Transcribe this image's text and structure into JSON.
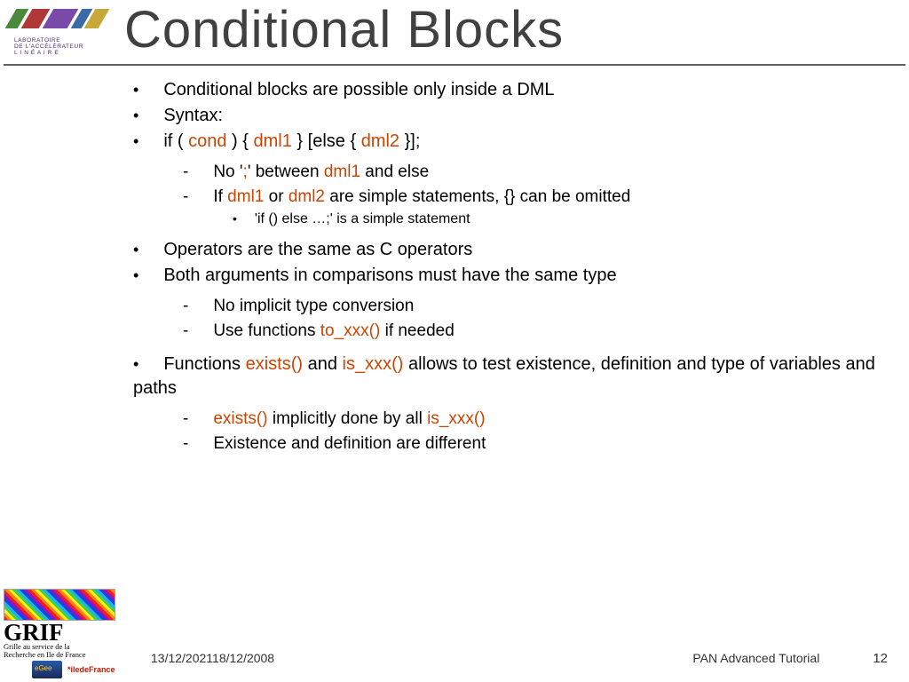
{
  "header": {
    "title": "Conditional Blocks",
    "logo_text_line1": "LABORATOIRE",
    "logo_text_line2": "DE L'ACCÉLÉRATEUR",
    "logo_text_line3": "L I N É A I R E"
  },
  "bullets": {
    "b1": "Conditional blocks are possible only inside a DML",
    "b2": "Syntax:",
    "b3_pre": "if ( ",
    "b3_cond": "cond",
    "b3_mid1": " ) { ",
    "b3_dml1": "dml1",
    "b3_mid2": " } [else { ",
    "b3_dml2": "dml2",
    "b3_end": " }];",
    "s1_a": "No '",
    "s1_b": ";",
    "s1_c": "' between ",
    "s1_d": "dml1",
    "s1_e": " and else",
    "s2_a": "If ",
    "s2_b": "dml1",
    "s2_c": " or ",
    "s2_d": "dml2",
    "s2_e": " are simple statements, {} can be omitted",
    "ss1": "'if () else …;' is a simple statement",
    "b4": "Operators are the same as C operators",
    "b5": "Both arguments in comparisons must have the same type",
    "s3": "No implicit type conversion",
    "s4_a": "Use functions ",
    "s4_b": "to_xxx()",
    "s4_c": " if needed",
    "b6_a": "Functions ",
    "b6_b": "exists()",
    "b6_c": " and ",
    "b6_d": "is_xxx()",
    "b6_e": " allows to test existence, definition and type of variables and paths",
    "s5_a": "exists()",
    "s5_b": " implicitly done by all ",
    "s5_c": "is_xxx()",
    "s6": "Existence and definition are different"
  },
  "footer": {
    "date": "13/12/202118/12/2008",
    "tutorial": "PAN Advanced Tutorial",
    "slide_num": "12"
  },
  "logos": {
    "grif": "GRIF",
    "grif_sub1": "Grille au service de la",
    "grif_sub2": "Recherche en Ile de France",
    "idf": "*iledeFrance"
  }
}
